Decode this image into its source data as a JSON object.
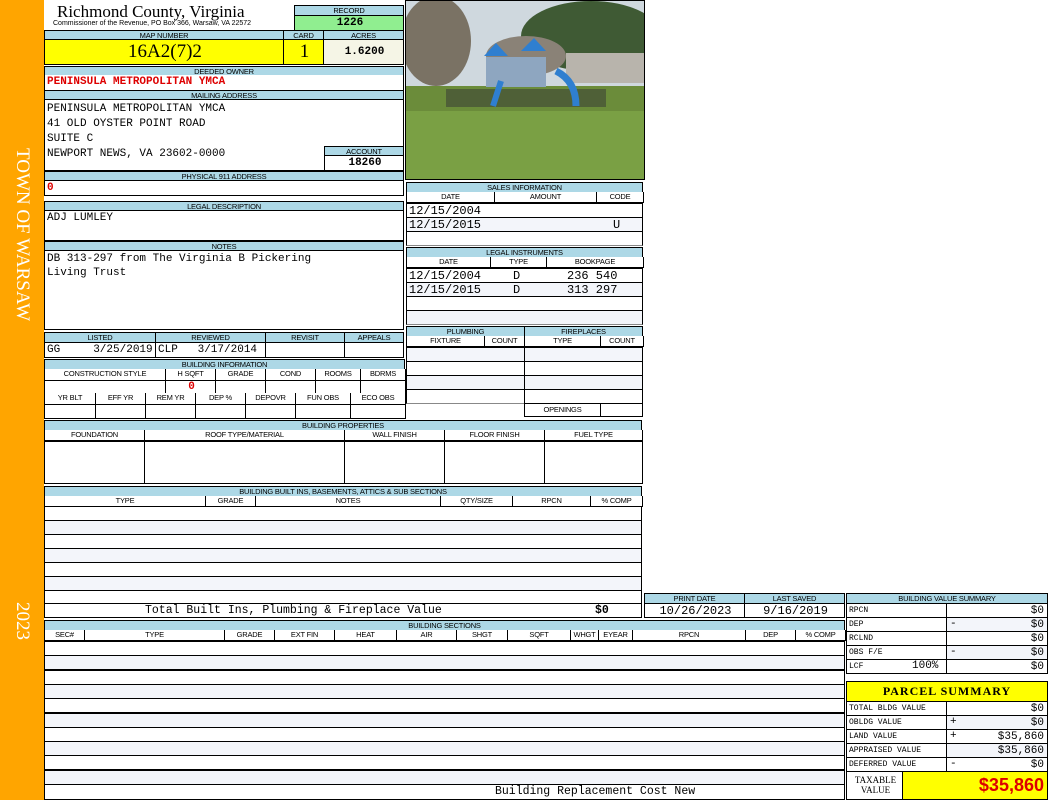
{
  "side": {
    "town": "TOWN OF WARSAW",
    "year": "2023"
  },
  "header": {
    "county": "Richmond County, Virginia",
    "subtitle": "Commissioner of the Revenue, PO Box 366, Warsaw, VA 22572",
    "record_label": "RECORD",
    "record": "1226"
  },
  "parcel": {
    "map_label": "MAP NUMBER",
    "map": "16A2(7)2",
    "card_label": "CARD",
    "card": "1",
    "acres_label": "ACRES",
    "acres": "1.6200"
  },
  "owner": {
    "label": "DEEDED OWNER",
    "name": "PENINSULA METROPOLITAN YMCA"
  },
  "mailing": {
    "label": "MAILING ADDRESS",
    "lines": [
      "PENINSULA METROPOLITAN YMCA",
      "41 OLD OYSTER POINT ROAD",
      "SUITE C",
      "NEWPORT NEWS, VA 23602-0000"
    ],
    "account_label": "ACCOUNT",
    "account": "18260"
  },
  "physical": {
    "label": "PHYSICAL 911 ADDRESS",
    "value": "0"
  },
  "legal": {
    "label": "LEGAL DESCRIPTION",
    "value": "ADJ LUMLEY"
  },
  "notes": {
    "label": "NOTES",
    "value": "DB 313-297 from The Virginia B Pickering\nLiving Trust"
  },
  "review": {
    "listed_label": "LISTED",
    "listed": "GG     3/25/2019",
    "reviewed_label": "REVIEWED",
    "reviewed": "CLP   3/17/2014",
    "revisit_label": "REVISIT",
    "appeals_label": "APPEALS"
  },
  "building_info": {
    "label": "BUILDING INFORMATION",
    "cols1": [
      "CONSTRUCTION STYLE",
      "H SQFT",
      "GRADE",
      "COND",
      "ROOMS",
      "BDRMS"
    ],
    "hsqft": "0",
    "cols2": [
      "YR BLT",
      "EFF YR",
      "REM YR",
      "DEP %",
      "DEPOVR",
      "FUN OBS",
      "ECO OBS"
    ]
  },
  "sales": {
    "label": "SALES INFORMATION",
    "cols": [
      "DATE",
      "AMOUNT",
      "CODE"
    ],
    "rows": [
      [
        "12/15/2004",
        "",
        ""
      ],
      [
        "12/15/2015",
        "",
        "U"
      ]
    ]
  },
  "instruments": {
    "label": "LEGAL INSTRUMENTS",
    "cols": [
      "DATE",
      "TYPE",
      "BOOKPAGE"
    ],
    "rows": [
      [
        "12/15/2004",
        "D",
        "236 540"
      ],
      [
        "12/15/2015",
        "D",
        "313 297"
      ]
    ]
  },
  "plumbing": {
    "label": "PLUMBING",
    "cols": [
      "FIXTURE",
      "COUNT"
    ]
  },
  "fireplaces": {
    "label": "FIREPLACES",
    "cols": [
      "TYPE",
      "COUNT"
    ],
    "openings": "OPENINGS"
  },
  "properties": {
    "label": "BUILDING PROPERTIES",
    "cols": [
      "FOUNDATION",
      "ROOF TYPE/MATERIAL",
      "WALL FINISH",
      "FLOOR FINISH",
      "FUEL TYPE"
    ]
  },
  "builtins": {
    "label": "BUILDING BUILT INS, BASEMENTS, ATTICS & SUB SECTIONS",
    "cols": [
      "TYPE",
      "GRADE",
      "NOTES",
      "QTY/SIZE",
      "RPCN",
      "% COMP"
    ],
    "total_label": "Total Built Ins, Plumbing & Fireplace Value",
    "total": "$0"
  },
  "dates": {
    "print_label": "PRINT DATE",
    "print": "10/26/2023",
    "saved_label": "LAST SAVED",
    "saved": "9/16/2019"
  },
  "sections": {
    "label": "BUILDING SECTIONS",
    "cols": [
      "SEC#",
      "TYPE",
      "GRADE",
      "EXT FIN",
      "HEAT",
      "AIR",
      "SHGT",
      "SQFT",
      "WHGT",
      "EYEAR",
      "RPCN",
      "DEP",
      "% COMP"
    ],
    "footer": "Building Replacement Cost New"
  },
  "value_summary": {
    "label": "BUILDING VALUE SUMMARY",
    "rows": [
      {
        "k": "RPCN",
        "op": "",
        "v": "$0"
      },
      {
        "k": "DEP",
        "op": "-",
        "v": "$0"
      },
      {
        "k": "RCLND",
        "op": "",
        "v": "$0"
      },
      {
        "k": "OBS F/E",
        "op": "-",
        "v": "$0"
      },
      {
        "k": "LCF",
        "pct": "100%",
        "op": "",
        "v": "$0"
      }
    ]
  },
  "parcel_summary": {
    "label": "PARCEL SUMMARY",
    "rows": [
      {
        "k": "TOTAL BLDG VALUE",
        "op": "",
        "v": "$0"
      },
      {
        "k": "OBLDG VALUE",
        "op": "+",
        "v": "$0"
      },
      {
        "k": "LAND VALUE",
        "op": "+",
        "v": "$35,860"
      },
      {
        "k": "APPRAISED VALUE",
        "op": "",
        "v": "$35,860"
      },
      {
        "k": "DEFERRED VALUE",
        "op": "-",
        "v": "$0"
      }
    ],
    "taxable_label": "TAXABLE VALUE",
    "taxable": "$35,860"
  },
  "colors": {
    "label_bg": "#ADD8E6",
    "sidebar": "#FFA500",
    "highlight": "#FFFF00",
    "record_bg": "#90EE90",
    "alert": "#DD0000"
  }
}
